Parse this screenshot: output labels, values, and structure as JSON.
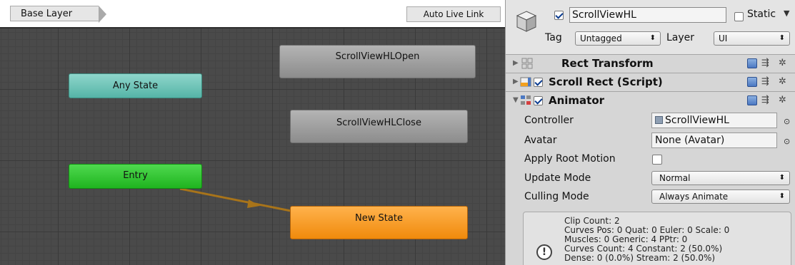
{
  "animator": {
    "breadcrumb": "Base Layer",
    "auto_live_link": "Auto Live Link",
    "states": {
      "open": "ScrollViewHLOpen",
      "close": "ScrollViewHLClose",
      "any": "Any State",
      "entry": "Entry",
      "new_state": "New State"
    },
    "colors": {
      "grid_bg": "#4a4a4a",
      "state_grey": "#a3a3a3",
      "any_state": "#6cc3b8",
      "entry": "#2cc52c",
      "default_state": "#f49a1f",
      "transition": "#a8741a"
    }
  },
  "inspector": {
    "object": {
      "name": "ScrollViewHL",
      "active": true,
      "static_label": "Static",
      "static": false,
      "tag_label": "Tag",
      "tag_value": "Untagged",
      "layer_label": "Layer",
      "layer_value": "UI",
      "icon": "cube-icon"
    },
    "components": [
      {
        "name": "Rect Transform",
        "icon": "rect-transform-icon"
      },
      {
        "name": "Scroll Rect (Script)",
        "icon": "script-icon",
        "enabled": true
      },
      {
        "name": "Animator",
        "icon": "animator-icon",
        "enabled": true
      }
    ],
    "animator_props": {
      "controller_label": "Controller",
      "controller_value": "ScrollViewHL",
      "avatar_label": "Avatar",
      "avatar_value": "None (Avatar)",
      "apply_root_motion_label": "Apply Root Motion",
      "apply_root_motion": false,
      "update_mode_label": "Update Mode",
      "update_mode_value": "Normal",
      "culling_mode_label": "Culling Mode",
      "culling_mode_value": "Always Animate"
    },
    "info": {
      "lines": [
        "Clip Count: 2",
        "Curves Pos: 0 Quat: 0 Euler: 0 Scale: 0",
        "Muscles: 0 Generic: 4 PPtr: 0",
        "Curves Count: 4 Constant: 2 (50.0%)",
        "Dense: 0 (0.0%) Stream: 2 (50.0%)"
      ]
    }
  }
}
